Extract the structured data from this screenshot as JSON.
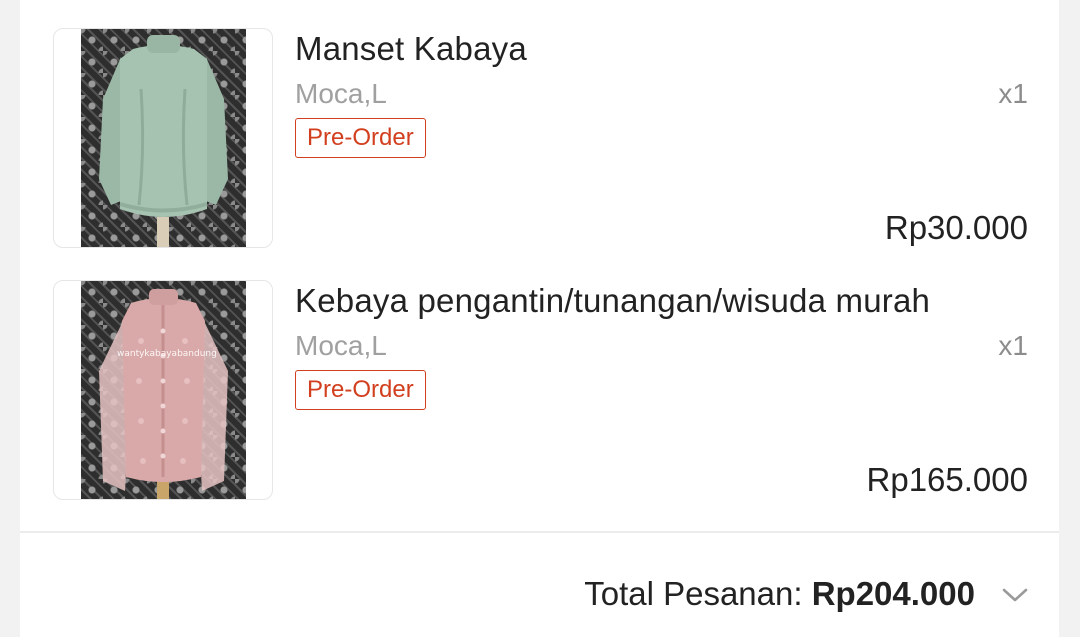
{
  "order": {
    "items": [
      {
        "name": "Manset Kabaya",
        "variant": "Moca,L",
        "quantity": "x1",
        "badge": "Pre-Order",
        "price": "Rp30.000",
        "image_desc": "sage green long-sleeve top on mannequin"
      },
      {
        "name": "Kebaya pengantin/tunangan/wisuda murah",
        "variant": "Moca,L",
        "quantity": "x1",
        "badge": "Pre-Order",
        "price": "Rp165.000",
        "image_desc": "dusty pink lace kebaya on mannequin",
        "image_watermark": "wantykabayabandung"
      }
    ],
    "total": {
      "label": "Total Pesanan: ",
      "amount": "Rp204.000"
    }
  },
  "colors": {
    "accent": "#d23f1e",
    "text": "#222222",
    "muted": "#a0a0a0",
    "background": "#f2f2f2"
  },
  "icons": {
    "expand": "chevron-down-icon"
  }
}
